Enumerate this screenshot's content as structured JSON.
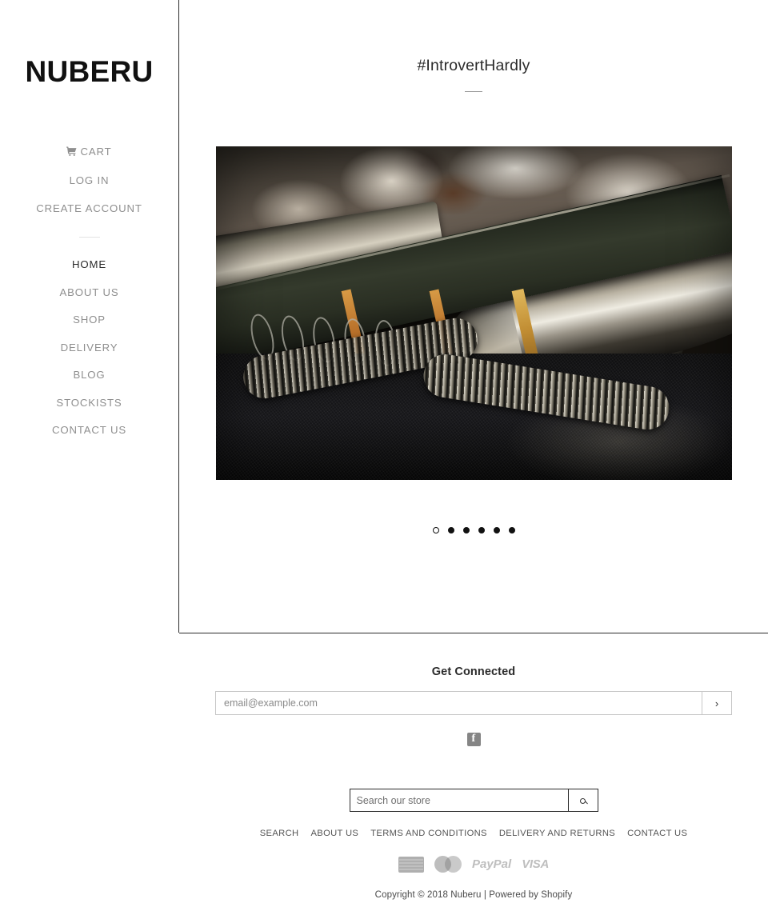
{
  "site": {
    "logo": "NUBERU"
  },
  "sidebar": {
    "account_links": [
      {
        "label": "CART",
        "icon": "shopping-cart-icon"
      },
      {
        "label": "LOG IN",
        "icon": ""
      },
      {
        "label": "CREATE ACCOUNT",
        "icon": ""
      }
    ],
    "nav_links": [
      {
        "label": "HOME",
        "active": true
      },
      {
        "label": "ABOUT US",
        "active": false
      },
      {
        "label": "SHOP",
        "active": false
      },
      {
        "label": "DELIVERY",
        "active": false
      },
      {
        "label": "BLOG",
        "active": false
      },
      {
        "label": "STOCKISTS",
        "active": false
      },
      {
        "label": "CONTACT US",
        "active": false
      }
    ]
  },
  "main": {
    "hero_title": "#IntrovertHardly",
    "slideshow": {
      "slide_alt": "Close-up photo of metal cuff and coiled spring bracelets on dark denim",
      "dots": [
        {
          "active": true
        },
        {
          "active": false
        },
        {
          "active": false
        },
        {
          "active": false
        },
        {
          "active": false
        },
        {
          "active": false
        }
      ]
    }
  },
  "footer": {
    "newsletter": {
      "heading": "Get Connected",
      "placeholder": "email@example.com",
      "value": "",
      "submit_label": "›",
      "submit_icon": "chevron-right-icon"
    },
    "social": [
      {
        "name": "facebook-icon",
        "label": "f"
      }
    ],
    "search": {
      "placeholder": "Search our store",
      "value": "",
      "button_icon": "search-icon"
    },
    "links": [
      {
        "label": "SEARCH"
      },
      {
        "label": "ABOUT US"
      },
      {
        "label": "TERMS AND CONDITIONS"
      },
      {
        "label": "DELIVERY AND RETURNS"
      },
      {
        "label": "CONTACT US"
      }
    ],
    "payments": [
      {
        "name": "american-express-icon",
        "label": "AMERICAN EXPRESS"
      },
      {
        "name": "mastercard-icon",
        "label": "MasterCard"
      },
      {
        "name": "paypal-icon",
        "label": "PayPal"
      },
      {
        "name": "visa-icon",
        "label": "VISA"
      }
    ],
    "copyright": "Copyright © 2018 Nuberu | Powered by Shopify"
  },
  "colors": {
    "text": "#2b2b2b",
    "muted": "#8f8f8f",
    "border": "#2b2b2b",
    "input_border": "#c6c6c6",
    "background": "#ffffff"
  }
}
